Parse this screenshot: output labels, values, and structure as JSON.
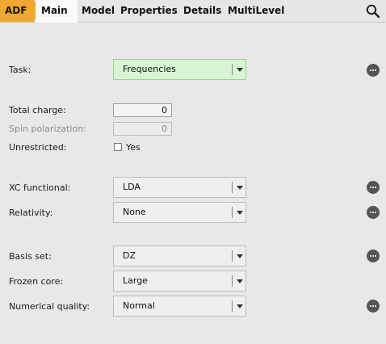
{
  "tabs": {
    "adf": "ADF",
    "items": [
      "Main",
      "Model",
      "Properties",
      "Details",
      "MultiLevel"
    ],
    "active": "Main",
    "accent_color": "#f0a830"
  },
  "icons": {
    "search": "search-icon",
    "more": "more-options-icon",
    "dropdown": "chevron-down-icon"
  },
  "form": {
    "task": {
      "label": "Task:",
      "value": "Frequencies",
      "bg_color": "#d8f5d3"
    },
    "total_charge": {
      "label": "Total charge:",
      "value": "0"
    },
    "spin_polarization": {
      "label": "Spin polarization:",
      "value": "0",
      "enabled": false
    },
    "unrestricted": {
      "label": "Unrestricted:",
      "checkbox_label": "Yes",
      "checked": false
    },
    "xc_functional": {
      "label": "XC functional:",
      "value": "LDA"
    },
    "relativity": {
      "label": "Relativity:",
      "value": "None"
    },
    "basis_set": {
      "label": "Basis set:",
      "value": "DZ"
    },
    "frozen_core": {
      "label": "Frozen core:",
      "value": "Large"
    },
    "numerical_quality": {
      "label": "Numerical quality:",
      "value": "Normal"
    }
  }
}
